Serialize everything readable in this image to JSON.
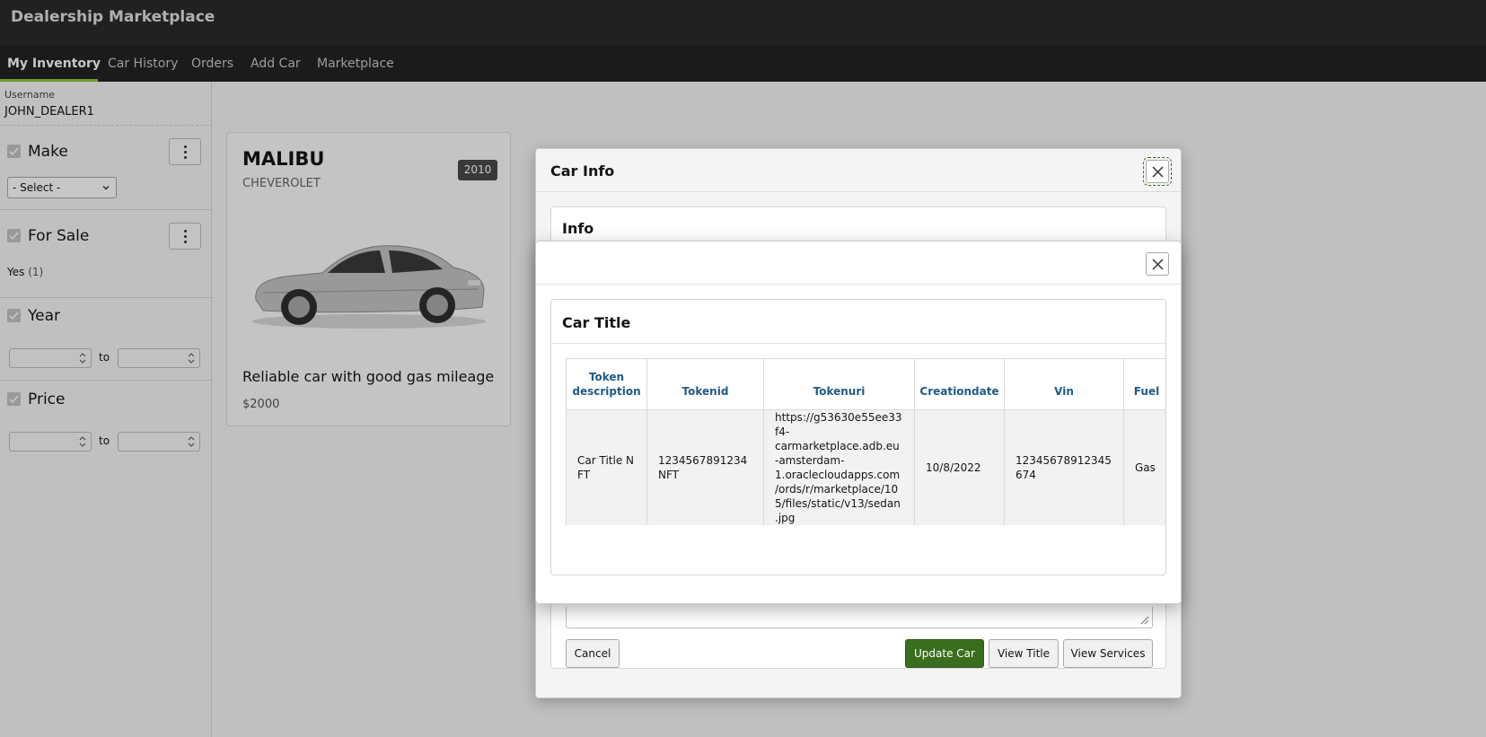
{
  "app": {
    "title": "Dealership Marketplace"
  },
  "nav": {
    "items": [
      {
        "label": "My Inventory"
      },
      {
        "label": "Car History"
      },
      {
        "label": "Orders"
      },
      {
        "label": "Add Car"
      },
      {
        "label": "Marketplace"
      }
    ],
    "active_index": 0
  },
  "sidebar": {
    "username_label": "Username",
    "username_value": "JOHN_DEALER1",
    "facets": {
      "make": {
        "heading": "Make",
        "select_value": "- Select -"
      },
      "for_sale": {
        "heading": "For Sale",
        "option_label": "Yes",
        "option_count": "(1)"
      },
      "year": {
        "heading": "Year",
        "to_label": "to"
      },
      "price": {
        "heading": "Price",
        "to_label": "to"
      }
    }
  },
  "card": {
    "model": "MALIBU",
    "make": "CHEVEROLET",
    "year": "2010",
    "description": "Reliable car with good gas mileage",
    "price": "$2000",
    "image_icon": "sedan-car-image"
  },
  "car_info_dialog": {
    "title": "Car Info",
    "region_title": "Info",
    "buttons": {
      "cancel": "Cancel",
      "update": "Update Car",
      "view_title": "View Title",
      "view_services": "View Services"
    }
  },
  "title_modal": {
    "region_title": "Car Title",
    "columns": [
      "Token description",
      "Tokenid",
      "Tokenuri",
      "Creationdate",
      "Vin",
      "Fuel"
    ],
    "rows": [
      {
        "token_description": "Car Title NFT",
        "tokenid": "1234567891234NFT",
        "tokenuri": "https://g53630e55ee33f4-carmarketplace.adb.eu-amsterdam-1.oraclecloudapps.com/ords/r/marketplace/105/files/static/v13/sedan.jpg",
        "creationdate": "10/8/2022",
        "vin": "12345678912345674",
        "fuel": "Gas"
      }
    ]
  },
  "colors": {
    "header_bg": "#2b2b2b",
    "nav_bg": "#232323",
    "nav_active_underline": "#8ec63f",
    "primary_button": "#3b6d1e",
    "column_header_text": "#1f5a86"
  }
}
